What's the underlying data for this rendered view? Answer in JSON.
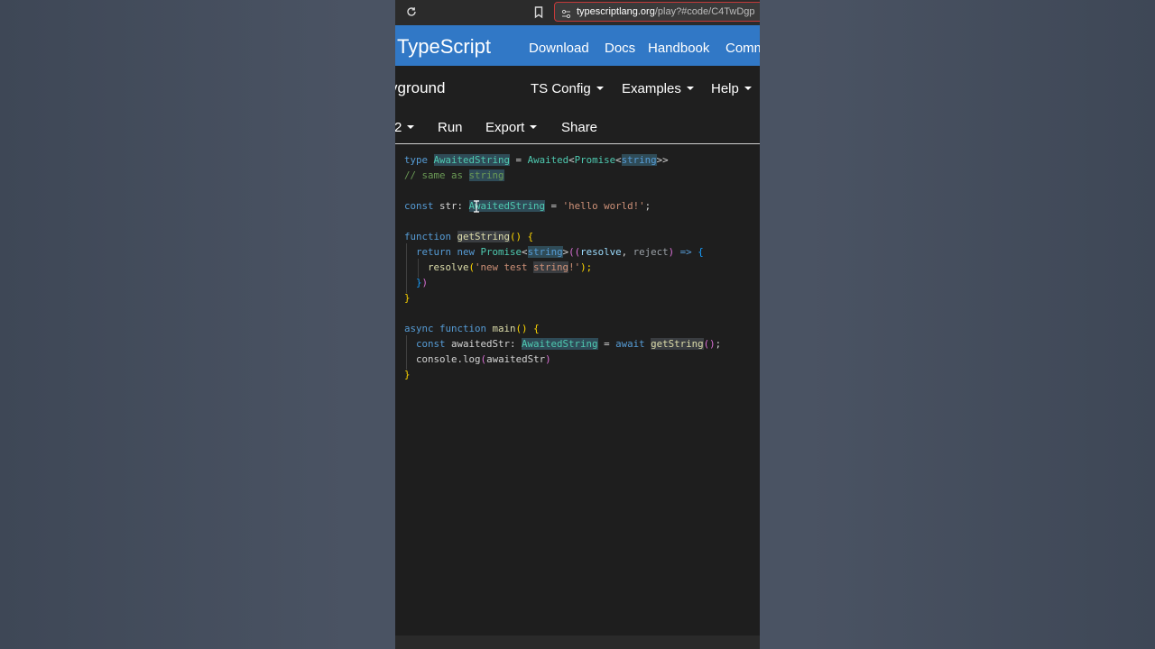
{
  "browser": {
    "url_domain": "typescriptlang.org",
    "url_path": "/play?#code/C4TwDgp"
  },
  "nav": {
    "brand": "TypeScript",
    "links": [
      "Download",
      "Docs",
      "Handbook",
      "Comm"
    ]
  },
  "playground": {
    "title": "yground",
    "menus": [
      "TS Config",
      "Examples",
      "Help"
    ]
  },
  "toolbar": {
    "version_fragment": "2",
    "run": "Run",
    "export": "Export",
    "share": "Share"
  },
  "code": {
    "l1": {
      "kw": "type",
      "name": "AwaitedString",
      "eq": " = ",
      "aw": "Awaited",
      "lt": "<",
      "pr": "Promise",
      "lt2": "<",
      "st": "string",
      "gt": ">>"
    },
    "l2": {
      "c": "// same as ",
      "st": "string"
    },
    "l4": {
      "kw": "const",
      "sp": " str: ",
      "ty": "AwaitedString",
      "eq": " = ",
      "s": "'hello world!'",
      "semi": ";"
    },
    "l6": {
      "kw": "function",
      "fn": "getString",
      "p": "()",
      "b": " {"
    },
    "l7": {
      "kw1": "return",
      "kw2": " new ",
      "ty": "Promise",
      "lt": "<",
      "st": "string",
      "gt": ">",
      "p1": "((",
      "a1": "resolve",
      "c": ", ",
      "a2": "reject",
      "p2": ")",
      "ar": " => ",
      "b": "{"
    },
    "l8": {
      "fn": "resolve",
      "p1": "(",
      "s1": "'new test ",
      "s2": "string",
      "s3": "!'",
      "p2": ");"
    },
    "l9": {
      "b": "}",
      "p": ")"
    },
    "l10": {
      "b": "}"
    },
    "l12": {
      "kw1": "async",
      "kw2": " function ",
      "fn": "main",
      "p": "()",
      "b": " {"
    },
    "l13": {
      "kw": "const",
      "v": " awaitedStr",
      "col": ": ",
      "ty": "AwaitedString",
      "eq": " = ",
      "kw2": "await",
      "sp": " ",
      "fn": "getString",
      "p": "()",
      "semi": ";"
    },
    "l14": {
      "obj": "console",
      "dot": ".",
      "fn": "log",
      "p1": "(",
      "v": "awaitedStr",
      "p2": ")"
    },
    "l15": {
      "b": "}"
    }
  },
  "colors": {
    "brand_blue": "#3178c6",
    "editor_bg": "#1e1e1e",
    "url_border": "#c43a3a"
  }
}
